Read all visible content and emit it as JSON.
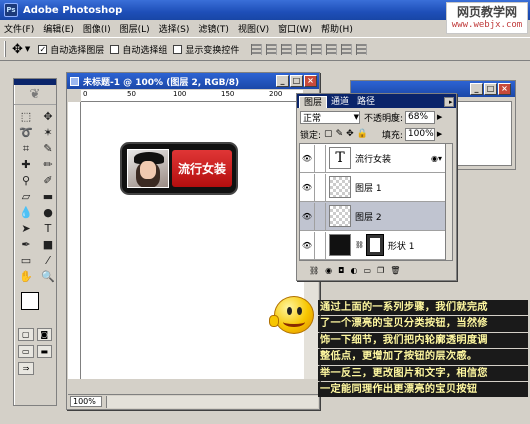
{
  "app": {
    "title": "Adobe Photoshop",
    "logo": "Ps"
  },
  "watermark": {
    "line1": "网页教学网",
    "line2": "www.webjx.com"
  },
  "menu": [
    "文件(F)",
    "编辑(E)",
    "图像(I)",
    "图层(L)",
    "选择(S)",
    "滤镜(T)",
    "视图(V)",
    "窗口(W)",
    "帮助(H)"
  ],
  "options": {
    "auto_select_layer": "自动选择图层",
    "auto_select_group": "自动选择组",
    "show_transform": "显示变换控件",
    "auto_select_layer_checked": true
  },
  "document": {
    "title": "未标题-1 @ 100% (图层 2, RGB/8)",
    "zoom": "100%",
    "ruler_marks": [
      "0",
      "50",
      "100",
      "150",
      "200"
    ],
    "button_text": "流行女装"
  },
  "layers_panel": {
    "tabs": [
      "图层",
      "通道",
      "路径"
    ],
    "blend_mode": "正常",
    "opacity_label": "不透明度:",
    "opacity_value": "68%",
    "lock_label": "锁定:",
    "fill_label": "填充:",
    "fill_value": "100%",
    "layers": [
      {
        "name": "流行女装",
        "thumb": "T",
        "type": "text",
        "selected": false
      },
      {
        "name": "图层 1",
        "type": "transparent",
        "selected": false
      },
      {
        "name": "图层 2",
        "type": "transparent",
        "selected": true
      },
      {
        "name": "形状 1",
        "type": "shape",
        "selected": false
      }
    ]
  },
  "caption": [
    "通过上面的一系列步骤，我们就完成",
    "了一个漂亮的宝贝分类按钮，当然修",
    "饰一下细节，我们把内轮廓透明度调",
    "整低点，更增加了按钮的层次感。",
    "举一反三，更改图片和文字，相信您",
    "一定能同理作出更漂亮的宝贝按钮"
  ],
  "colors": {
    "titlebar": "#1e4fb8",
    "button_red": "#c81c1c",
    "caption_text": "#fff8a0"
  }
}
